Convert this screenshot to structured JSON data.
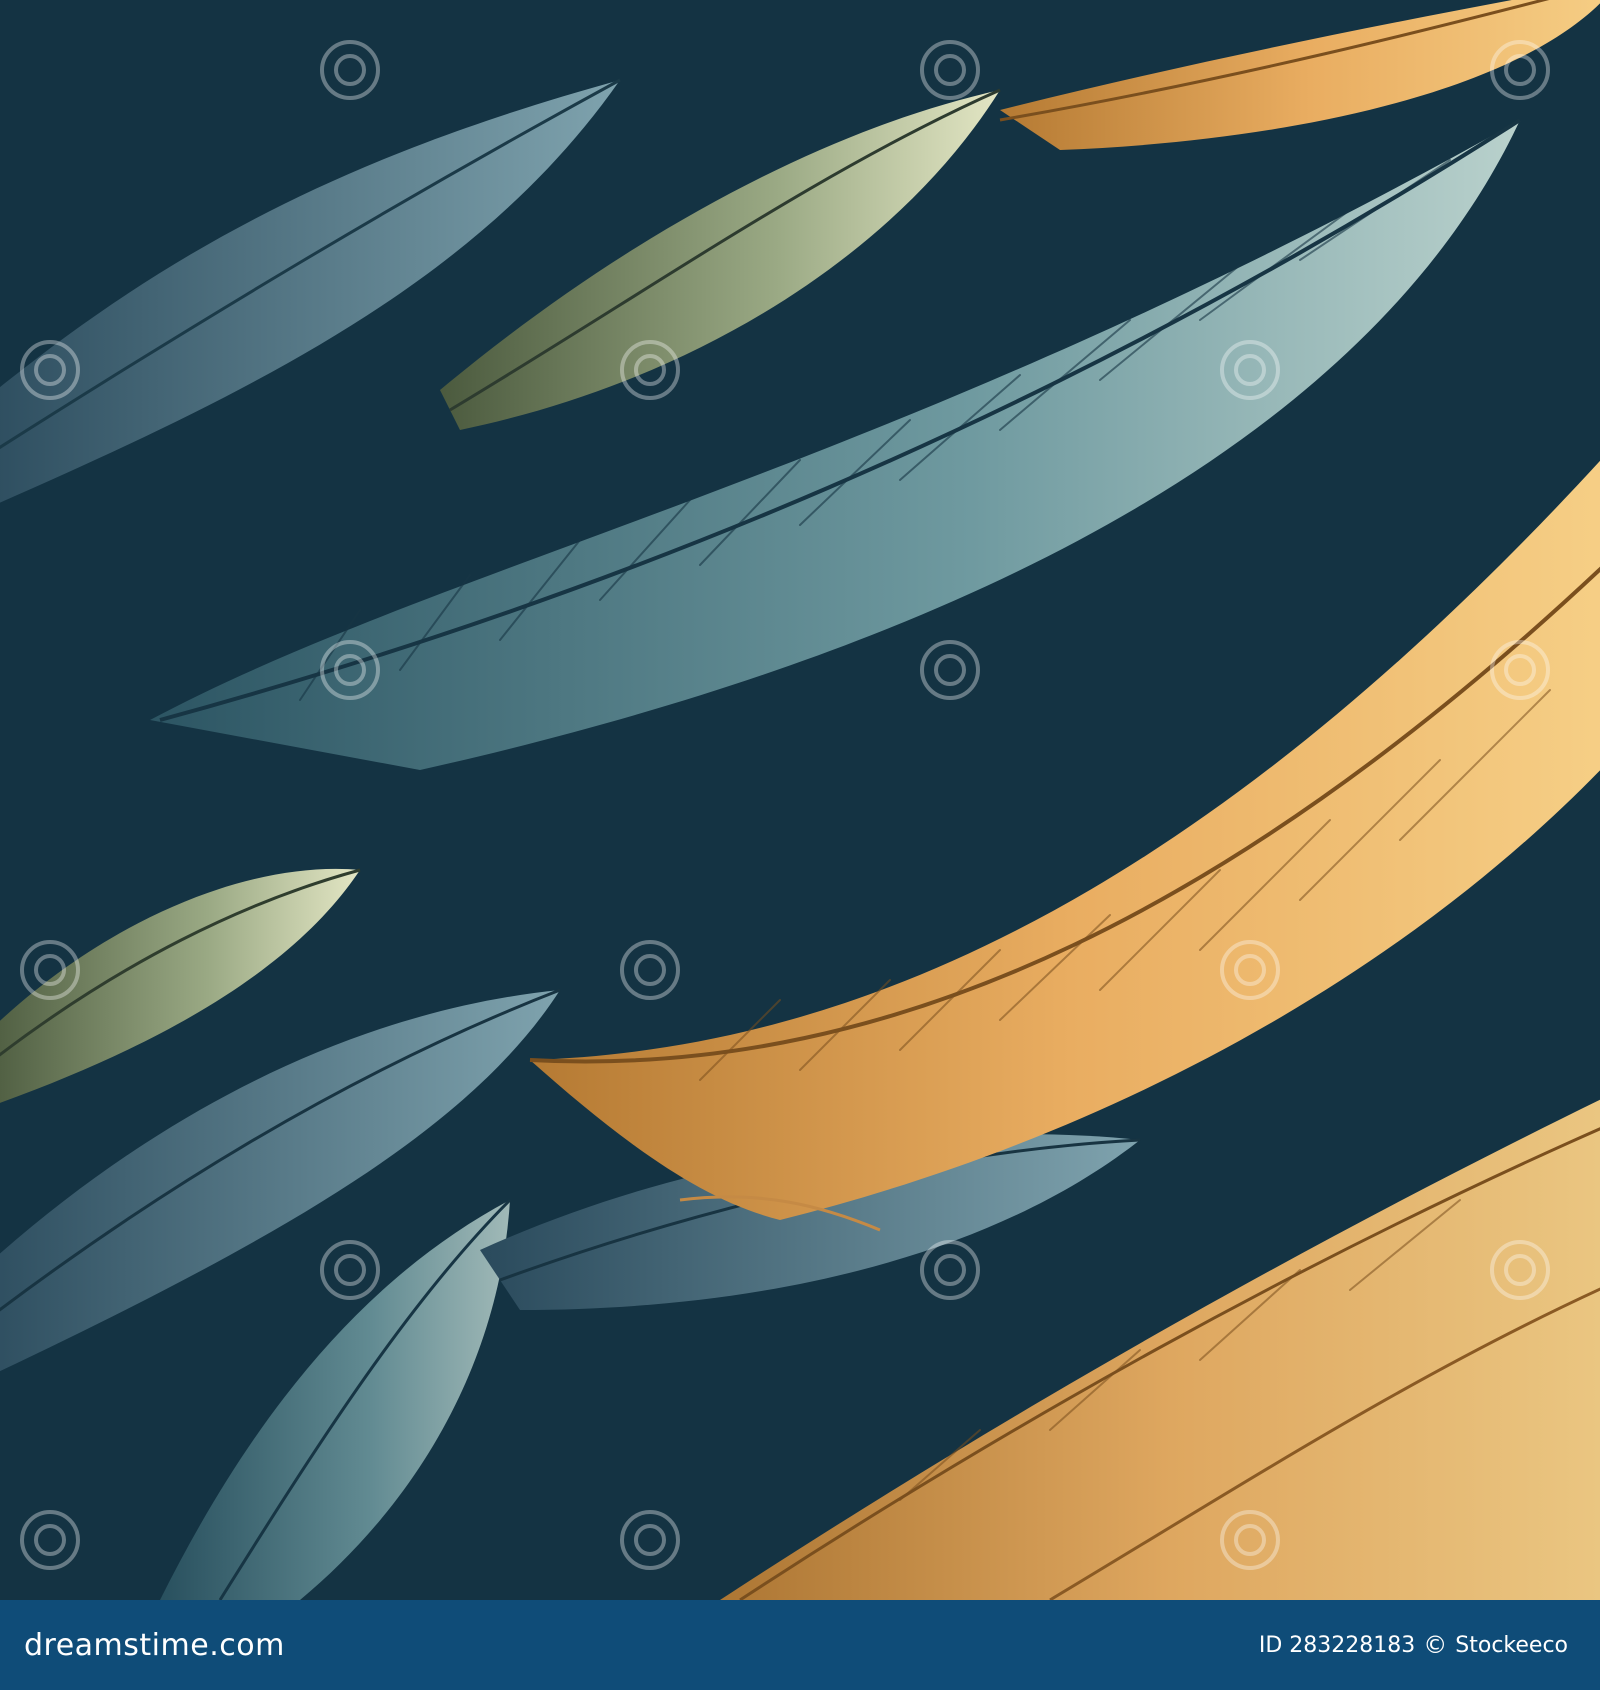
{
  "image": {
    "subject": "painted feathers pattern",
    "palette": {
      "teal": "#5f8a92",
      "dark": "#12303c",
      "sage": "#b7c39a",
      "gold": "#e7ad5c",
      "amber": "#f0c06a"
    },
    "watermark": "dreamstime"
  },
  "footer": {
    "site": "dreamstime.com",
    "id_label": "ID 283228183",
    "copyright_symbol": "©",
    "author": "Stockeeco"
  }
}
